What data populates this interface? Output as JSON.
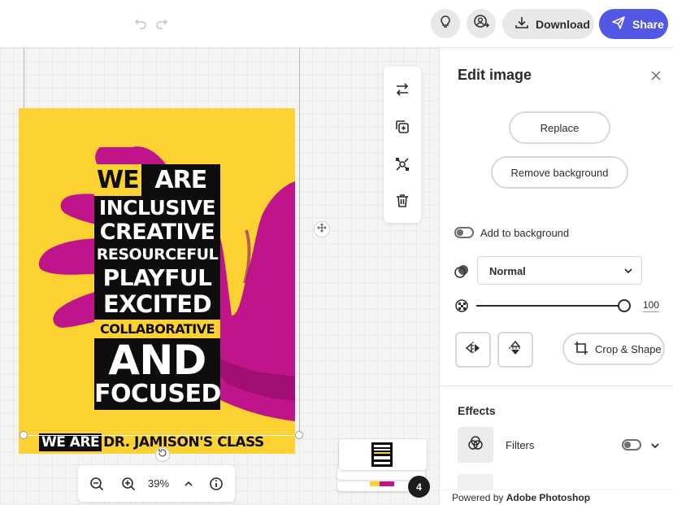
{
  "topbar": {
    "download_label": "Download",
    "share_label": "Share",
    "icons": [
      "undo-icon",
      "redo-icon",
      "lightbulb-icon",
      "add-collaborator-icon",
      "download-icon",
      "share-send-icon"
    ]
  },
  "poster": {
    "lines": [
      "INCLUSIVE",
      "CREATIVE",
      "RESOURCEFUL",
      "PLAYFUL",
      "EXCITED"
    ],
    "we": "WE",
    "are": "ARE",
    "collaborative": "COLLABORATIVE",
    "and": "AND",
    "focused": "FOCUSED",
    "footer_we_are": "WE ARE",
    "footer_class": "DR. JAMISON'S CLASS",
    "colors": {
      "background": "#fcd232",
      "hand": "#c0158a",
      "text_block": "#0d0d0d"
    }
  },
  "canvas": {
    "zoom": "39%",
    "page_count": "4"
  },
  "panel": {
    "title": "Edit image",
    "replace_label": "Replace",
    "remove_bg_label": "Remove background",
    "add_to_bg_label": "Add to background",
    "blend_mode": "Normal",
    "opacity": "100",
    "crop_label": "Crop & Shape",
    "effects_title": "Effects",
    "filters_label": "Filters",
    "powered_prefix": "Powered by ",
    "powered_brand": "Adobe Photoshop"
  },
  "colors": {
    "accent": "#5258e4"
  }
}
